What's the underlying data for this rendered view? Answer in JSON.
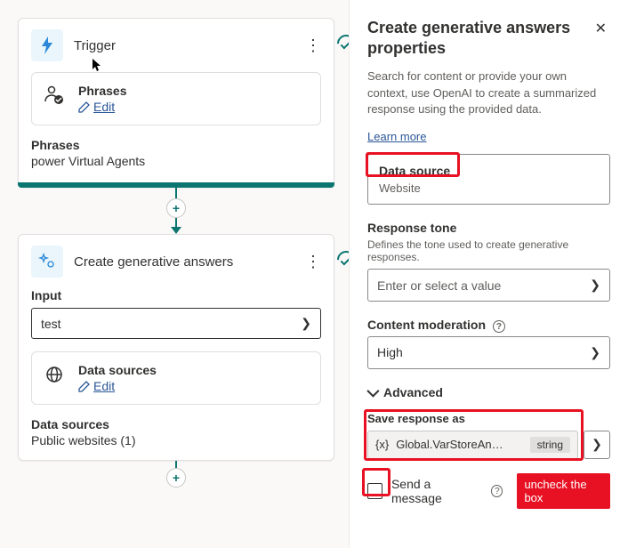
{
  "canvas": {
    "trigger": {
      "title": "Trigger",
      "phrases_card": {
        "label": "Phrases",
        "edit": "Edit"
      },
      "footer": {
        "label": "Phrases",
        "value": "power Virtual Agents"
      }
    },
    "gen": {
      "title": "Create generative answers",
      "input": {
        "label": "Input",
        "value": "test"
      },
      "ds_card": {
        "label": "Data sources",
        "edit": "Edit"
      },
      "footer": {
        "label": "Data sources",
        "value": "Public websites (1)"
      }
    }
  },
  "panel": {
    "title": "Create generative answers properties",
    "desc": "Search for content or provide your own context, use OpenAI to create a summarized response using the provided data.",
    "learn": "Learn more",
    "ds": {
      "label": "Data source",
      "value": "Website"
    },
    "tone": {
      "label": "Response tone",
      "desc": "Defines the tone used to create generative responses.",
      "placeholder": "Enter or select a value"
    },
    "moderation": {
      "label": "Content moderation",
      "value": "High"
    },
    "advanced": "Advanced",
    "save_as": {
      "label": "Save response as",
      "var": "Global.VarStoreAn…",
      "type": "string"
    },
    "send_msg": "Send a message",
    "annotation": "uncheck the box"
  }
}
